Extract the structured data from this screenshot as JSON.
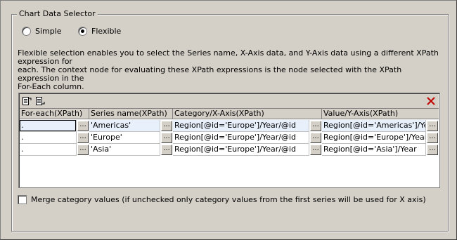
{
  "group": {
    "title": "Chart Data Selector"
  },
  "mode": {
    "options": [
      {
        "label": "Simple",
        "selected": false
      },
      {
        "label": "Flexible",
        "selected": true
      }
    ]
  },
  "description": "Flexible selection enables you to select the Series name, X-Axis data, and Y-Axis data using a different XPath expression for\neach. The context node for evaluating these XPath expressions is the node selected with the XPath expression in the\nFor-Each column.",
  "toolbar": {
    "icons": [
      "insert-row-icon",
      "append-row-icon",
      "delete-row-icon"
    ],
    "delete_color": "#c00000"
  },
  "grid": {
    "headers": [
      "For-each(XPath)",
      "Series name(XPath)",
      "Category/X-Axis(XPath)",
      "Value/Y-Axis(XPath)"
    ],
    "rows": [
      [
        ".",
        "'Americas'",
        "Region[@id='Europe']/Year/@id",
        "Region[@id='Americas']/Year"
      ],
      [
        ".",
        "'Europe'",
        "Region[@id='Europe']/Year/@id",
        "Region[@id='Europe']/Year"
      ],
      [
        ".",
        "'Asia'",
        "Region[@id='Europe']/Year/@id",
        "Region[@id='Asia']/Year"
      ]
    ],
    "button_label": "..."
  },
  "merge": {
    "label": "Merge category values (if unchecked only category values from the first series will be used for X axis)",
    "checked": false
  }
}
